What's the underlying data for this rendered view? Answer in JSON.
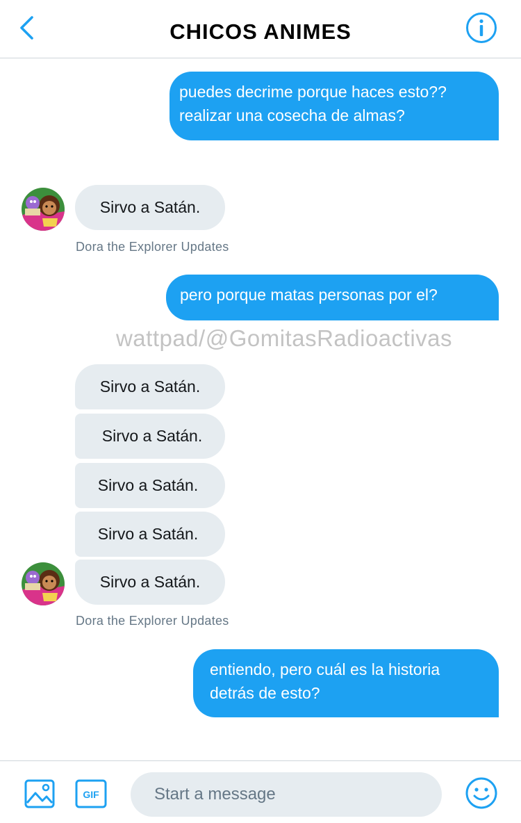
{
  "header": {
    "title": "CHICOS ANIMES",
    "back_icon": "chevron-left-icon",
    "info_icon": "info-icon"
  },
  "accent_color": "#1da1f2",
  "incoming_color": "#e6ecf0",
  "messages": [
    {
      "direction": "sent",
      "text": "puedes decrime porque haces esto??\nrealizar una cosecha de almas?"
    },
    {
      "direction": "received",
      "text": "Sirvo a Satán.",
      "sender": "Dora the Explorer Updates"
    },
    {
      "direction": "sent",
      "text": "pero porque matas personas por el?"
    },
    {
      "direction": "received",
      "text": "Sirvo a Satán."
    },
    {
      "direction": "received",
      "text": "Sirvo a Satán."
    },
    {
      "direction": "received",
      "text": "Sirvo a Satán."
    },
    {
      "direction": "received",
      "text": "Sirvo a Satán."
    },
    {
      "direction": "received",
      "text": "Sirvo a Satán.",
      "sender": "Dora the Explorer Updates"
    },
    {
      "direction": "sent",
      "text": "entiendo, pero cuál es la historia\ndetrás de esto?"
    }
  ],
  "watermark": "wattpad/@GomitasRadioactivas",
  "composer": {
    "placeholder": "Start a message",
    "media_icon": "image-icon",
    "gif_label": "GIF",
    "emoji_icon": "smiley-icon"
  }
}
